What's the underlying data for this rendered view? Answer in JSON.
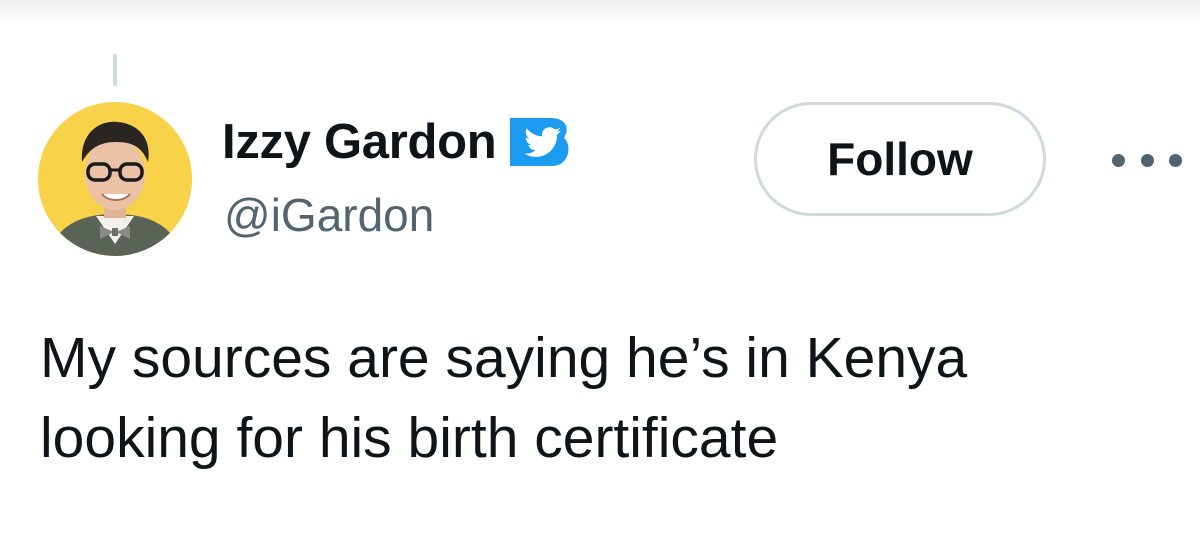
{
  "author": {
    "display_name": "Izzy Gardon",
    "handle": "@iGardon",
    "verified_badge_icon": "twitter-bird-badge-icon",
    "badge_color": "#1d9bf0",
    "avatar_background": "#f8d34a"
  },
  "actions": {
    "follow_label": "Follow",
    "more_icon": "more-horizontal-icon"
  },
  "tweet": {
    "text_lines": [
      "My sources are saying he’s in Kenya",
      "looking for his birth certificate"
    ]
  }
}
